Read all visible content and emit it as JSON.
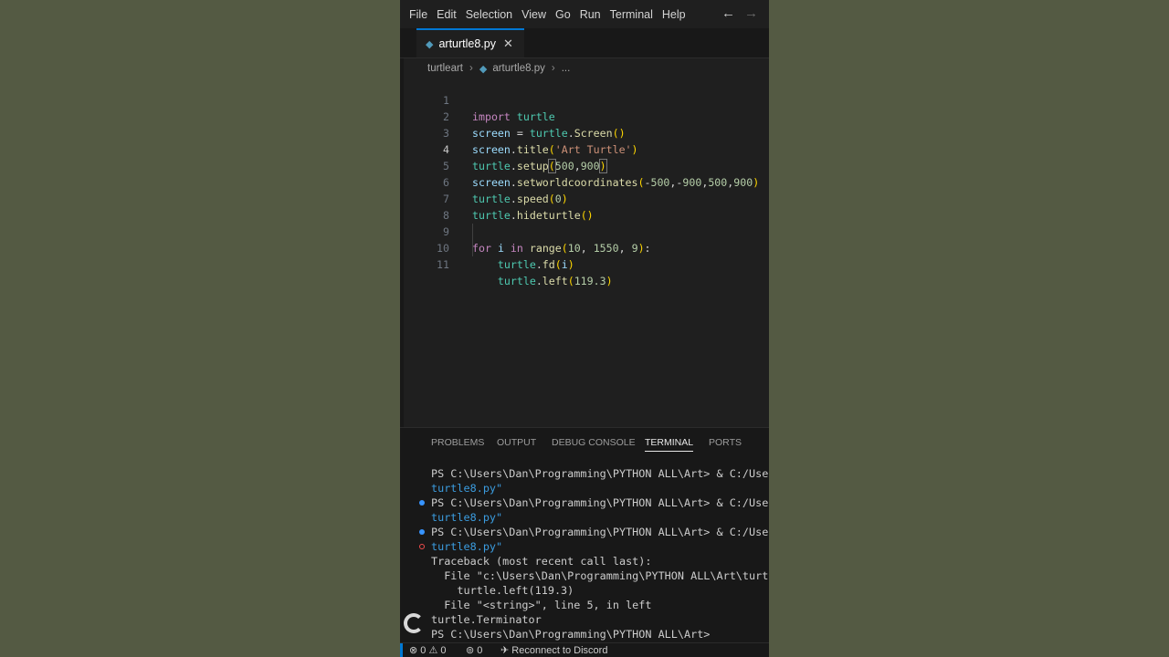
{
  "menu": {
    "items": [
      "File",
      "Edit",
      "Selection",
      "View",
      "Go",
      "Run",
      "Terminal",
      "Help"
    ],
    "back": "←",
    "forward": "→"
  },
  "tab": {
    "label": "arturtle8.py",
    "close": "✕"
  },
  "breadcrumb": {
    "folder": "turtleart",
    "file": "arturtle8.py",
    "more": "..."
  },
  "editor": {
    "active_line": 4,
    "line_numbers": [
      "1",
      "2",
      "3",
      "4",
      "5",
      "6",
      "7",
      "8",
      "9",
      "10",
      "11"
    ]
  },
  "panel": {
    "tabs": [
      "PROBLEMS",
      "OUTPUT",
      "DEBUG CONSOLE",
      "TERMINAL",
      "PORTS"
    ],
    "active_tab": "TERMINAL"
  },
  "terminal": {
    "lines": [
      "PS C:\\Users\\Dan\\Programming\\PYTHON ALL\\Art> & C:/User",
      "turtle8.py\"",
      "PS C:\\Users\\Dan\\Programming\\PYTHON ALL\\Art> & C:/User",
      "turtle8.py\"",
      "PS C:\\Users\\Dan\\Programming\\PYTHON ALL\\Art> & C:/User",
      "turtle8.py\"",
      "Traceback (most recent call last):",
      "  File \"c:\\Users\\Dan\\Programming\\PYTHON ALL\\Art\\turtl",
      "    turtle.left(119.3)",
      "  File \"<string>\", line 5, in left",
      "turtle.Terminator",
      "PS C:\\Users\\Dan\\Programming\\PYTHON ALL\\Art>"
    ]
  },
  "status": {
    "errors": "0",
    "warnings": "0",
    "ports": "0",
    "discord": "Reconnect to Discord"
  },
  "colors": {
    "accent": "#0078d4",
    "editor_bg": "#1f1f1f",
    "background": "#545a43"
  }
}
